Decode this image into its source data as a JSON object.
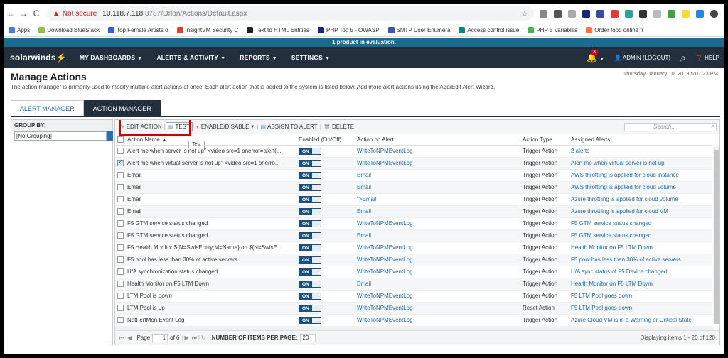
{
  "browser": {
    "not_secure": "Not secure",
    "url_host": "10.118.7.118",
    "url_path": ":8787/Orion/Actions/Default.aspx",
    "bookmarks": [
      {
        "label": "Apps",
        "color": "#4a7bd4"
      },
      {
        "label": "Download BlueStack",
        "color": "#8bc34a"
      },
      {
        "label": "Top Female Artists o",
        "color": "#3b5bdb"
      },
      {
        "label": "InsightVM Security C",
        "color": "#e53935"
      },
      {
        "label": "Text to HTML Entities",
        "color": "#222222"
      },
      {
        "label": "PHP Top 5 - OWASP",
        "color": "#1a237e"
      },
      {
        "label": "SMTP User Enumera",
        "color": "#3f51b5"
      },
      {
        "label": "Access control issue",
        "color": "#00897b"
      },
      {
        "label": "PHP 5 Variables",
        "color": "#4caf50"
      },
      {
        "label": "Order food online fr",
        "color": "#ff7043"
      }
    ]
  },
  "eval_banner": "1 product in evaluation.",
  "nav": {
    "logo": "solarwinds",
    "menus": [
      "MY DASHBOARDS",
      "ALERTS & ACTIVITY",
      "REPORTS",
      "SETTINGS"
    ],
    "bell_count": "3",
    "user": "ADMIN (LOGOUT)",
    "help": "HELP"
  },
  "page": {
    "title": "Manage Actions",
    "datetime": "Thursday, January 10, 2019 5:07:23 PM",
    "description": "The action manager is primarily used to modify multiple alert actions at once. Each alert action that is added to the system is listed below. Add more alert actions using the Add/Edit Alert Wizard."
  },
  "tabs": [
    "ALERT MANAGER",
    "ACTION MANAGER"
  ],
  "group": {
    "label": "GROUP BY:",
    "value": "[No Grouping]"
  },
  "toolbar": {
    "edit": "EDIT ACTION",
    "test": "TEST",
    "enable": "ENABLE/DISABLE",
    "assign": "ASSIGN TO ALERT",
    "delete": "DELETE",
    "search_placeholder": "Search...",
    "tooltip": "Test"
  },
  "columns": [
    "Action Name",
    "Enabled (On/Off)",
    "Action on Alert",
    "Action Type",
    "Assigned Alerts"
  ],
  "toggle_label": "ON",
  "rows": [
    {
      "name": "Alert me when server is not up\" <video src=1 onerror=alert(...",
      "action": "WriteToNPMEventLog",
      "type": "Trigger Action",
      "assigned": "2 alerts",
      "checked": false
    },
    {
      "name": "Alert me when virtual server is not up\" <video src=1 onerro...",
      "action": "WriteToNPMEventLog",
      "type": "Trigger Action",
      "assigned": "Alert me when virtual server is not up",
      "checked": true
    },
    {
      "name": "Email",
      "action": "Email",
      "type": "Trigger Action",
      "assigned": "AWS throttling is applied for cloud instance",
      "checked": false
    },
    {
      "name": "Email",
      "action": "Email",
      "type": "Trigger Action",
      "assigned": "AWS throttling is applied for cloud volume",
      "checked": false
    },
    {
      "name": "Email",
      "action": "\">Email",
      "type": "Trigger Action",
      "assigned": "Azure throttling is applied for cloud volume",
      "checked": false
    },
    {
      "name": "Email",
      "action": "Email",
      "type": "Trigger Action",
      "assigned": "Azure throttling is applied for cloud VM",
      "checked": false
    },
    {
      "name": "F5 GTM service status changed",
      "action": "WriteToNPMEventLog",
      "type": "Trigger Action",
      "assigned": "F5 GTM service status changed",
      "checked": false
    },
    {
      "name": "F5 GTM service status changed",
      "action": "Email",
      "type": "Trigger Action",
      "assigned": "F5 GTM service status changed",
      "checked": false
    },
    {
      "name": "F5 Health Monitor ${N=SwisEntity;M=Name} on ${N=SwisE...",
      "action": "WriteToNPMEventLog",
      "type": "Trigger Action",
      "assigned": "Health Monitor on F5 LTM Down",
      "checked": false
    },
    {
      "name": "F5 pool has less than 30% of active servers",
      "action": "WriteToNPMEventLog",
      "type": "Trigger Action",
      "assigned": "F5 pool has less than 30% of active servers",
      "checked": false
    },
    {
      "name": "H/A synchronization status changed",
      "action": "WriteToNPMEventLog",
      "type": "Trigger Action",
      "assigned": "H/A sync status of F5 Device changed",
      "checked": false
    },
    {
      "name": "Health Monitor on F5 LTM Down",
      "action": "Email",
      "type": "Trigger Action",
      "assigned": "Health Monitor on F5 LTM Down",
      "checked": false
    },
    {
      "name": "LTM Pool is down",
      "action": "WriteToNPMEventLog",
      "type": "Trigger Action",
      "assigned": "F5 LTM Pool goes down",
      "checked": false
    },
    {
      "name": "LTM Pool is up",
      "action": "WriteToNPMEventLog",
      "type": "Reset Action",
      "assigned": "F5 LTM Pool goes down",
      "checked": false
    },
    {
      "name": "NetFerfMon Event Log",
      "action": "WriteToNPMEventLog",
      "type": "Trigger Action",
      "assigned": "Azure Cloud VM is in a Warning or Critical State",
      "checked": false
    }
  ],
  "pager": {
    "page_label": "Page",
    "page": "1",
    "of": "of 6",
    "items_label": "NUMBER OF ITEMS PER PAGE:",
    "items_per_page": "20",
    "displaying": "Displaying items 1 - 20 of 120"
  }
}
